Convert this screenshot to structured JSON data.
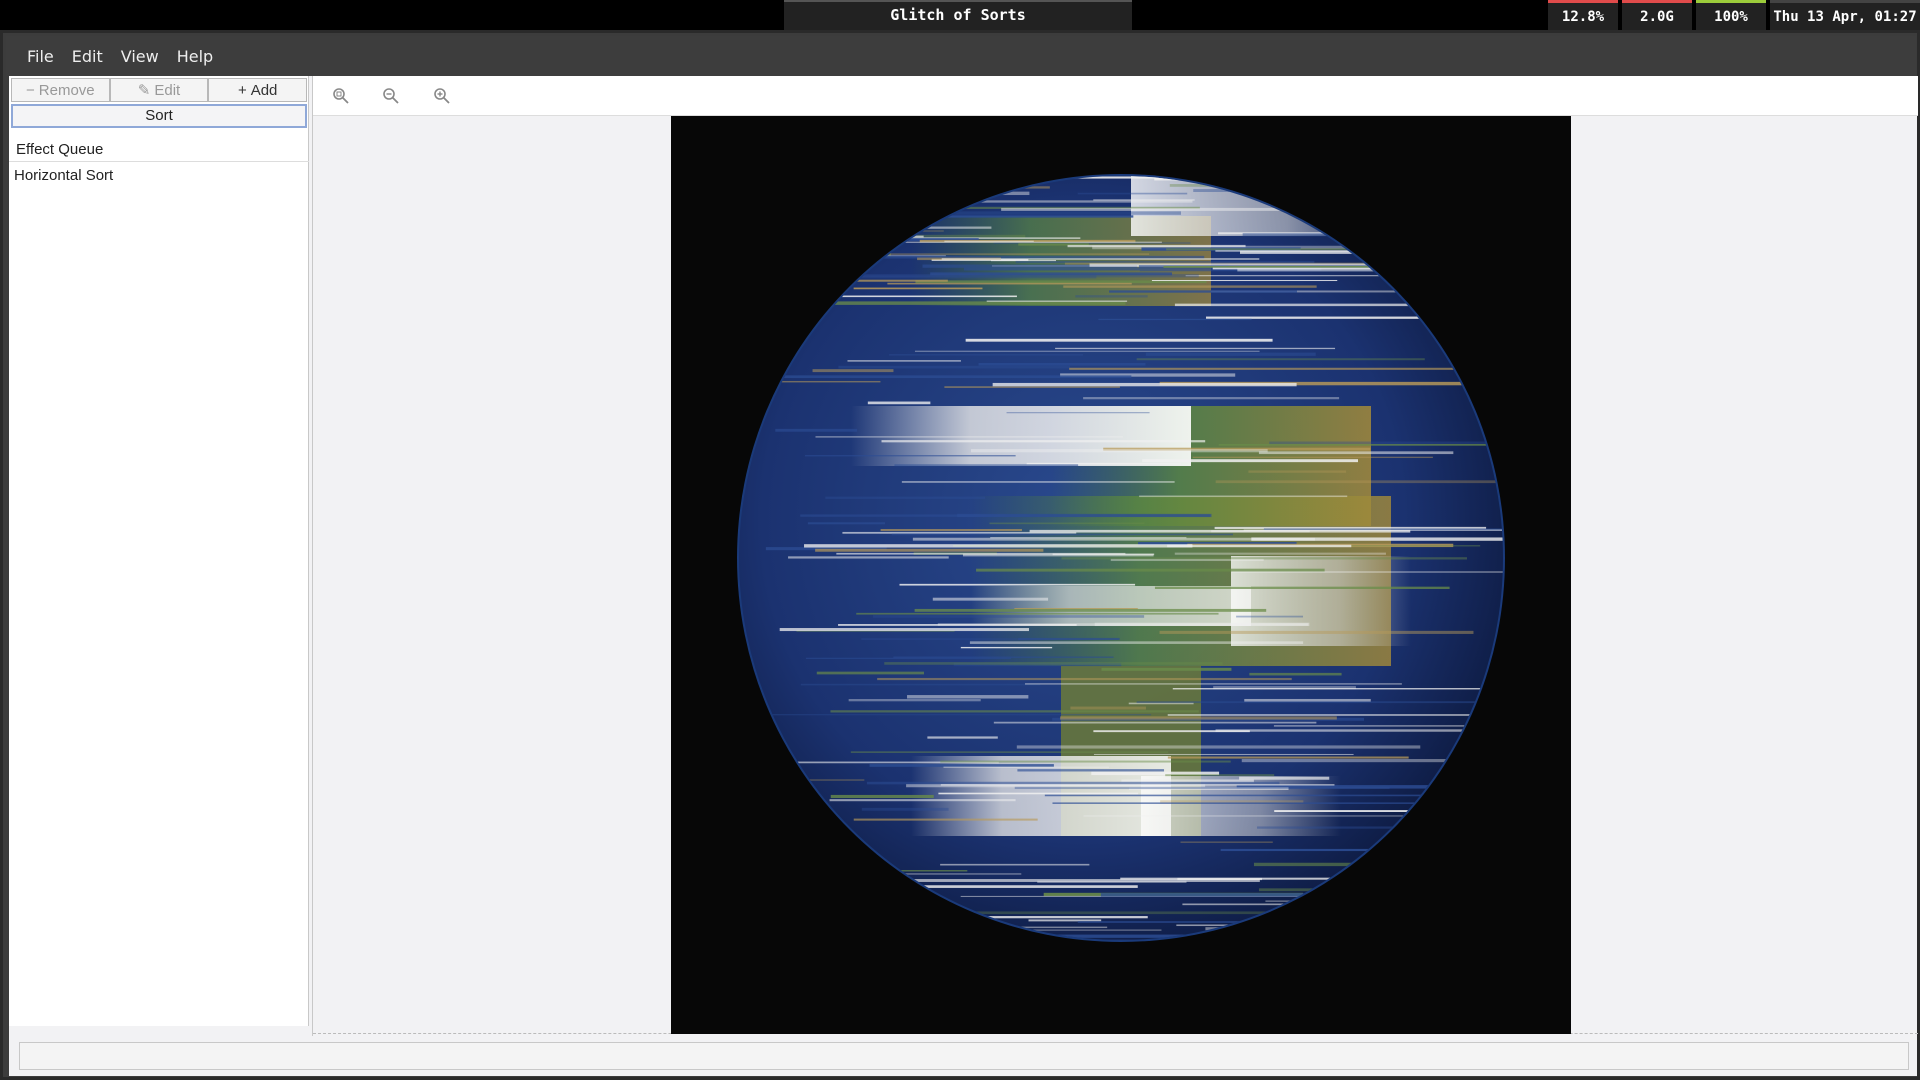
{
  "system_bar": {
    "window_title": "Glitch of Sorts",
    "cpu": "12.8%",
    "memory": "2.0G",
    "battery": "100%",
    "clock": "Thu 13 Apr, 01:27"
  },
  "menu": {
    "file": "File",
    "edit": "Edit",
    "view": "View",
    "help": "Help"
  },
  "left_panel": {
    "remove_label": "Remove",
    "edit_label": "Edit",
    "add_label": "Add",
    "sort_label": "Sort",
    "list_header": "Effect Queue",
    "items": [
      {
        "label": "Horizontal Sort"
      }
    ]
  },
  "toolbar": {
    "icons": [
      "zoom-fit-icon",
      "zoom-out-icon",
      "zoom-in-icon"
    ]
  },
  "canvas": {
    "image": "pixel-sorted earth",
    "background": "#070707"
  },
  "colors": {
    "accent": "#8fa8d8",
    "ocean": "#1d3a7a",
    "land": "#4a7a3a",
    "cloud": "#e8e8e8"
  }
}
